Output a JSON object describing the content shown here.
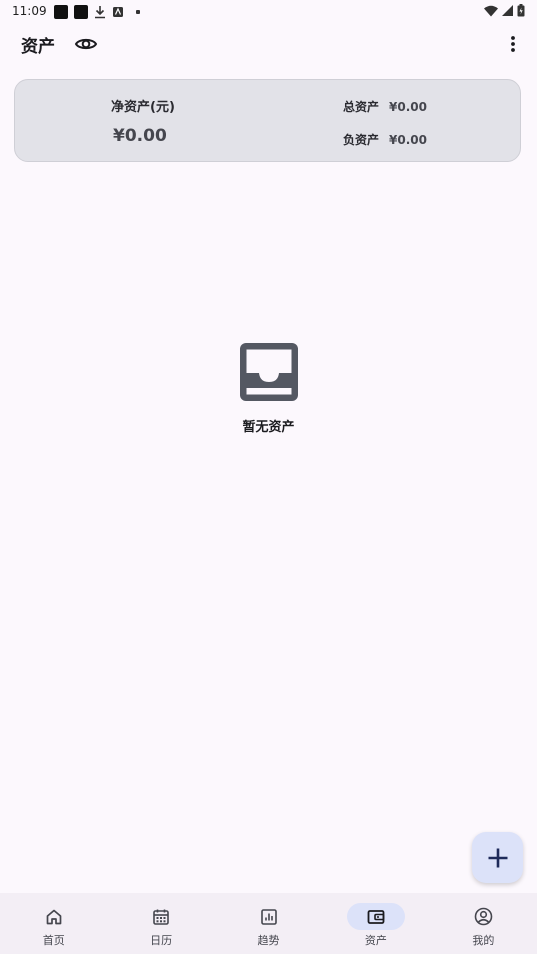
{
  "status_bar": {
    "time": "11:09"
  },
  "app_bar": {
    "title": "资产"
  },
  "summary": {
    "net_label": "净资产(元)",
    "net_value": "¥0.00",
    "total_label": "总资产",
    "total_value": "¥0.00",
    "debt_label": "负资产",
    "debt_value": "¥0.00"
  },
  "empty": {
    "text": "暂无资产"
  },
  "nav": {
    "items": [
      {
        "label": "首页",
        "icon": "home-icon"
      },
      {
        "label": "日历",
        "icon": "calendar-icon"
      },
      {
        "label": "趋势",
        "icon": "chart-icon"
      },
      {
        "label": "资产",
        "icon": "wallet-icon",
        "active": true
      },
      {
        "label": "我的",
        "icon": "account-icon"
      }
    ]
  },
  "colors": {
    "background": "#fcf8fd",
    "card": "#e2e2e8",
    "accent_container": "#dce2f9",
    "primary_dark": "#1e2a5a"
  }
}
